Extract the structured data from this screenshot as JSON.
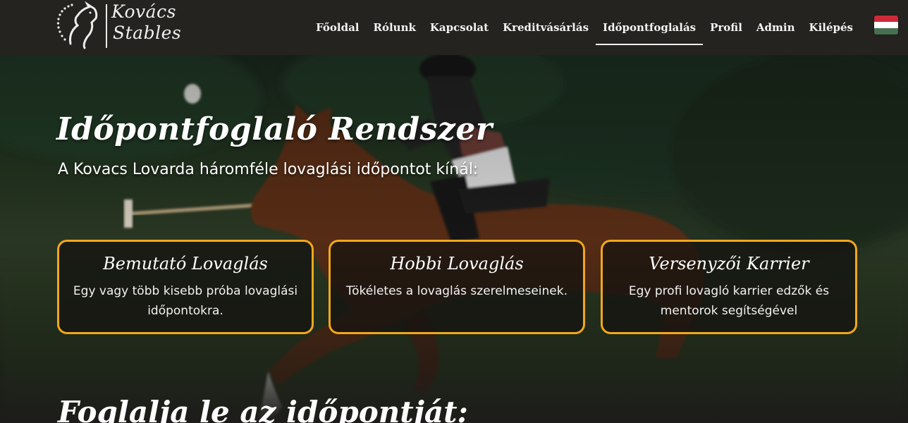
{
  "brand": {
    "line1": "Kovács",
    "line2": "Stables"
  },
  "nav": {
    "items": [
      {
        "label": "Főoldal",
        "active": false
      },
      {
        "label": "Rólunk",
        "active": false
      },
      {
        "label": "Kapcsolat",
        "active": false
      },
      {
        "label": "Kreditvásárlás",
        "active": false
      },
      {
        "label": "Időpontfoglalás",
        "active": true
      },
      {
        "label": "Profil",
        "active": false
      },
      {
        "label": "Admin",
        "active": false
      },
      {
        "label": "Kilépés",
        "active": false
      }
    ],
    "language_flag": {
      "icon": "hungarian-flag-icon",
      "colors": [
        "#ce2939",
        "#ffffff",
        "#477050"
      ]
    }
  },
  "hero": {
    "title": "Időpontfoglaló Rendszer",
    "subtitle": "A Kovacs Lovarda háromféle lovaglási időpontot kínál:"
  },
  "cards": [
    {
      "title": "Bemutató Lovaglás",
      "description": "Egy vagy több kisebb próba lovaglási időpontokra."
    },
    {
      "title": "Hobbi Lovaglás",
      "description": "Tökéletes a lovaglás szerelmeseinek."
    },
    {
      "title": "Versenyzői Karrier",
      "description": "Egy profi lovagló karrier edzők és mentorok segítségével"
    }
  ],
  "booking": {
    "title": "Foglalja le az időpontját:"
  },
  "colors": {
    "header_bg": "#252320",
    "card_border": "#f2a71b",
    "page_bg": "#1d1c1a"
  }
}
